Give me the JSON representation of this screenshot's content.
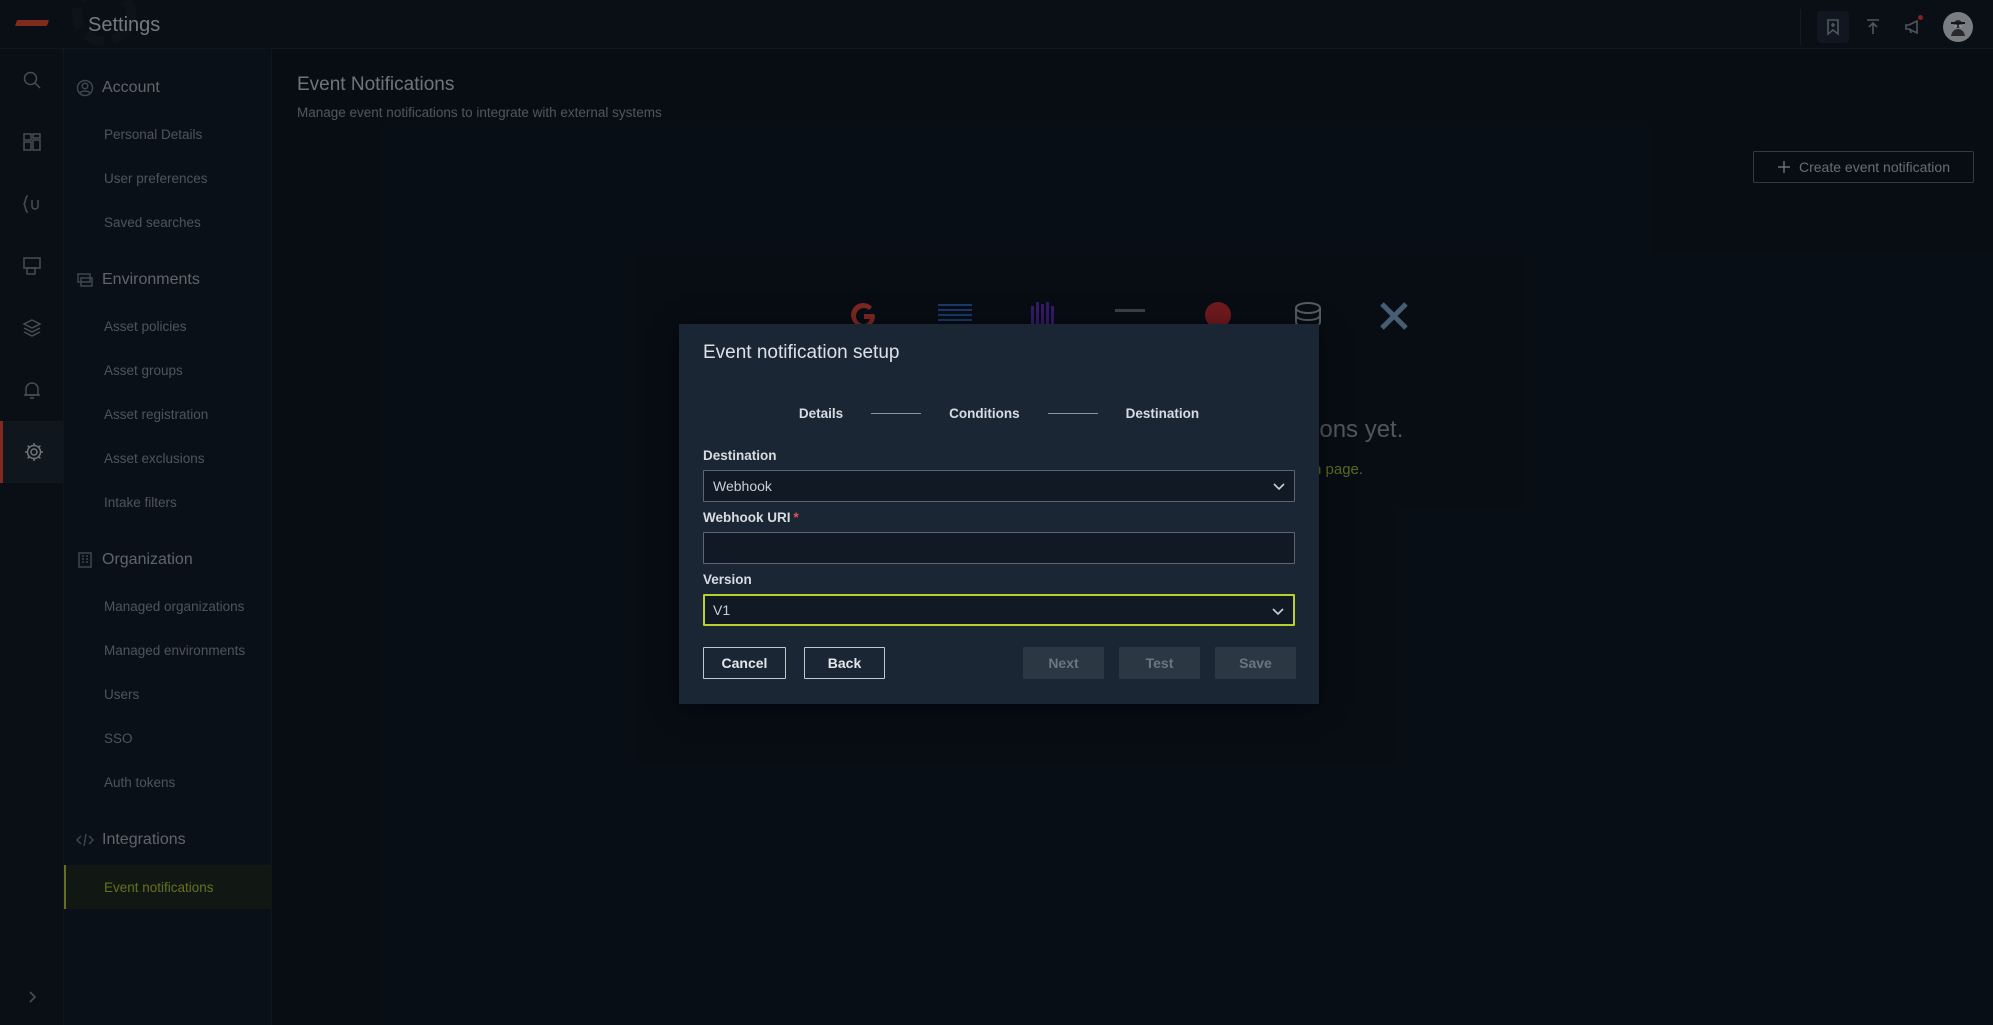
{
  "app": {
    "title": "Settings"
  },
  "topbar": {
    "icons": [
      "bookmark-icon",
      "upload-icon",
      "megaphone-icon",
      "avatar-icon"
    ]
  },
  "rail": {
    "items": [
      "search-icon",
      "dashboard-icon",
      "query-icon",
      "reports-icon",
      "layers-icon",
      "bell-icon",
      "gear-icon"
    ],
    "active": "gear-icon"
  },
  "sidebar": {
    "sections": [
      {
        "title": "Account",
        "icon": "user-icon",
        "items": [
          "Personal Details",
          "User preferences",
          "Saved searches"
        ]
      },
      {
        "title": "Environments",
        "icon": "environments-icon",
        "items": [
          "Asset policies",
          "Asset groups",
          "Asset registration",
          "Asset exclusions",
          "Intake filters"
        ]
      },
      {
        "title": "Organization",
        "icon": "building-icon",
        "items": [
          "Managed organizations",
          "Managed environments",
          "Users",
          "SSO",
          "Auth tokens"
        ]
      },
      {
        "title": "Integrations",
        "icon": "code-icon",
        "items": [
          "Event notifications"
        ]
      }
    ],
    "active_item": "Event notifications"
  },
  "main": {
    "title": "Event Notifications",
    "subtitle": "Manage event notifications to integrate with external systems",
    "create_label": "Create event notification",
    "empty_title_visible": "fications yet.",
    "empty_link_visible": "n page."
  },
  "modal": {
    "title": "Event notification setup",
    "steps": [
      "Details",
      "Conditions",
      "Destination"
    ],
    "destination": {
      "label": "Destination",
      "value": "Webhook"
    },
    "webhook_uri": {
      "label": "Webhook URI",
      "required_mark": "*",
      "value": ""
    },
    "version": {
      "label": "Version",
      "value": "V1"
    },
    "buttons": {
      "cancel": "Cancel",
      "back": "Back",
      "next": "Next",
      "test": "Test",
      "save": "Save"
    }
  },
  "colors": {
    "accent": "#b4c436",
    "brand": "#e8472c",
    "required": "#e05555"
  }
}
